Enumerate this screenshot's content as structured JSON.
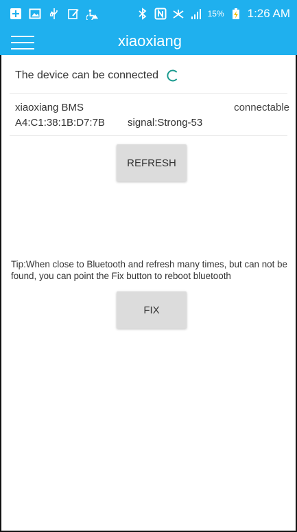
{
  "status_bar": {
    "battery_percent": "15%",
    "time": "1:26 AM",
    "icons": [
      "add-box-icon",
      "image-icon",
      "usb-icon",
      "edit-note-icon",
      "accessibility-icon",
      "bluetooth-icon",
      "nfc-icon",
      "mute-icon",
      "signal-icon",
      "battery-charging-icon"
    ]
  },
  "app_bar": {
    "title": "xiaoxiang",
    "menu_icon": "hamburger-menu-icon"
  },
  "scan": {
    "status_text": "The device can be connected",
    "spinner_icon": "loading-spinner-icon"
  },
  "device": {
    "name": "xiaoxiang BMS",
    "state": "connectable",
    "mac": "A4:C1:38:1B:D7:7B",
    "signal": "signal:Strong-53"
  },
  "buttons": {
    "refresh_label": "REFRESH",
    "fix_label": "FIX"
  },
  "tip": "Tip:When close to Bluetooth and refresh many times, but can not be found, you can point the Fix button to reboot bluetooth",
  "colors": {
    "app_bar": "#1fb0ee",
    "spinner": "#1a9a8e",
    "button": "#dcdcdc"
  }
}
